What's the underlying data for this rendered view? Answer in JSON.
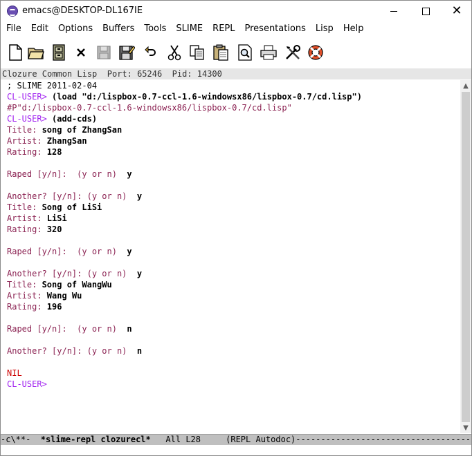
{
  "window": {
    "title": "emacs@DESKTOP-DL167IE",
    "min_label": "—",
    "max_label": "☐",
    "close_label": "✕"
  },
  "menu": {
    "items": [
      "File",
      "Edit",
      "Options",
      "Buffers",
      "Tools",
      "SLIME",
      "REPL",
      "Presentations",
      "Lisp",
      "Help"
    ]
  },
  "toolbar": {
    "buttons": [
      "new-file-icon",
      "open-folder-icon",
      "cabinet-icon",
      "close-x-icon",
      "save-disk-icon",
      "save-as-icon",
      "undo-icon",
      "cut-icon",
      "copy-icon",
      "paste-icon",
      "search-icon",
      "print-icon",
      "preferences-icon",
      "help-lifebuoy-icon"
    ]
  },
  "header_line": "Clozure Common Lisp  Port: 65246  Pid: 14300",
  "repl": {
    "lines": [
      {
        "segments": [
          {
            "cls": "plain",
            "text": "; SLIME 2011-02-04"
          }
        ]
      },
      {
        "segments": [
          {
            "cls": "prompt",
            "text": "CL-USER> "
          },
          {
            "cls": "input",
            "text": "(load \"d:/lispbox-0.7-ccl-1.6-windowsx86/lispbox-0.7/cd.lisp\")"
          }
        ]
      },
      {
        "segments": [
          {
            "cls": "output",
            "text": "#P\"d:/lispbox-0.7-ccl-1.6-windowsx86/lispbox-0.7/cd.lisp\""
          }
        ]
      },
      {
        "segments": [
          {
            "cls": "prompt",
            "text": "CL-USER> "
          },
          {
            "cls": "input",
            "text": "(add-cds)"
          }
        ]
      },
      {
        "segments": [
          {
            "cls": "output",
            "text": "Title: "
          },
          {
            "cls": "input",
            "text": "song of ZhangSan"
          }
        ]
      },
      {
        "segments": [
          {
            "cls": "output",
            "text": "Artist: "
          },
          {
            "cls": "input",
            "text": "ZhangSan"
          }
        ]
      },
      {
        "segments": [
          {
            "cls": "output",
            "text": "Rating: "
          },
          {
            "cls": "input",
            "text": "128"
          }
        ]
      },
      {
        "segments": [
          {
            "cls": "plain",
            "text": ""
          }
        ]
      },
      {
        "segments": [
          {
            "cls": "output",
            "text": "Raped [y/n]:  (y or n)  "
          },
          {
            "cls": "input",
            "text": "y"
          }
        ]
      },
      {
        "segments": [
          {
            "cls": "plain",
            "text": ""
          }
        ]
      },
      {
        "segments": [
          {
            "cls": "output",
            "text": "Another? [y/n]: (y or n)  "
          },
          {
            "cls": "input",
            "text": "y"
          }
        ]
      },
      {
        "segments": [
          {
            "cls": "output",
            "text": "Title: "
          },
          {
            "cls": "input",
            "text": "Song of LiSi"
          }
        ]
      },
      {
        "segments": [
          {
            "cls": "output",
            "text": "Artist: "
          },
          {
            "cls": "input",
            "text": "LiSi"
          }
        ]
      },
      {
        "segments": [
          {
            "cls": "output",
            "text": "Rating: "
          },
          {
            "cls": "input",
            "text": "320"
          }
        ]
      },
      {
        "segments": [
          {
            "cls": "plain",
            "text": ""
          }
        ]
      },
      {
        "segments": [
          {
            "cls": "output",
            "text": "Raped [y/n]:  (y or n)  "
          },
          {
            "cls": "input",
            "text": "y"
          }
        ]
      },
      {
        "segments": [
          {
            "cls": "plain",
            "text": ""
          }
        ]
      },
      {
        "segments": [
          {
            "cls": "output",
            "text": "Another? [y/n]: (y or n)  "
          },
          {
            "cls": "input",
            "text": "y"
          }
        ]
      },
      {
        "segments": [
          {
            "cls": "output",
            "text": "Title: "
          },
          {
            "cls": "input",
            "text": "Song of WangWu"
          }
        ]
      },
      {
        "segments": [
          {
            "cls": "output",
            "text": "Artist: "
          },
          {
            "cls": "input",
            "text": "Wang Wu"
          }
        ]
      },
      {
        "segments": [
          {
            "cls": "output",
            "text": "Rating: "
          },
          {
            "cls": "input",
            "text": "196"
          }
        ]
      },
      {
        "segments": [
          {
            "cls": "plain",
            "text": ""
          }
        ]
      },
      {
        "segments": [
          {
            "cls": "output",
            "text": "Raped [y/n]:  (y or n)  "
          },
          {
            "cls": "input",
            "text": "n"
          }
        ]
      },
      {
        "segments": [
          {
            "cls": "plain",
            "text": ""
          }
        ]
      },
      {
        "segments": [
          {
            "cls": "output",
            "text": "Another? [y/n]: (y or n)  "
          },
          {
            "cls": "input",
            "text": "n"
          }
        ]
      },
      {
        "segments": [
          {
            "cls": "plain",
            "text": ""
          }
        ]
      },
      {
        "segments": [
          {
            "cls": "err",
            "text": "NIL"
          }
        ]
      },
      {
        "segments": [
          {
            "cls": "prompt",
            "text": "CL-USER> "
          }
        ]
      }
    ]
  },
  "modeline": {
    "prefix": "-c\\**-  ",
    "buffer_name": "*slime-repl clozurecl*",
    "position": "   All L28     ",
    "modes": "(REPL Autodoc)",
    "fill": "-----------------------------------------"
  },
  "scrollbar": {
    "up_glyph": "▲",
    "down_glyph": "▼"
  },
  "colors": {
    "prompt": "#a020f0",
    "output": "#8b2252",
    "nil": "#cd0000"
  }
}
